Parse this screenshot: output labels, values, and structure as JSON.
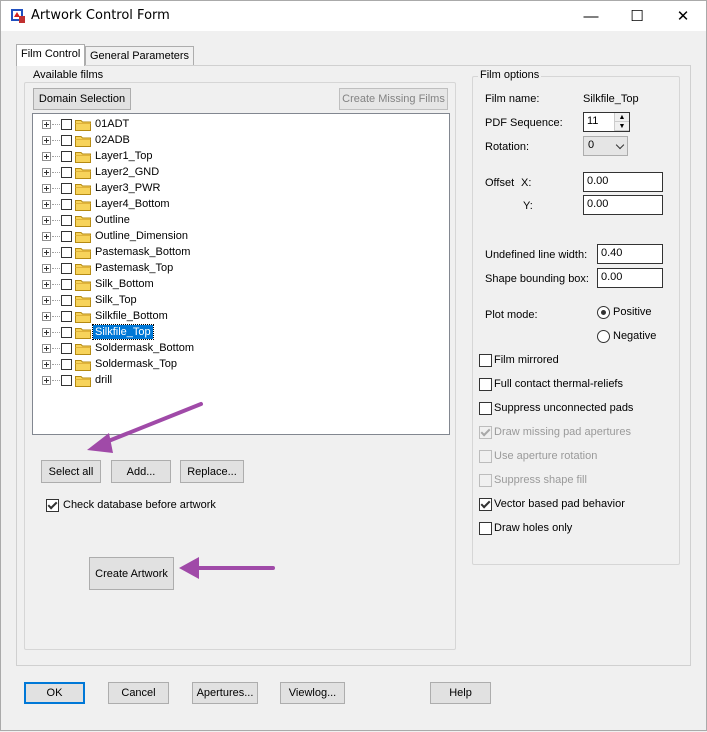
{
  "window": {
    "title": "Artwork Control Form",
    "minimize": "—",
    "maximize": "☐",
    "close": "✕"
  },
  "tabs": [
    {
      "label": "Film Control",
      "active": true
    },
    {
      "label": "General Parameters",
      "active": false
    }
  ],
  "available_films": {
    "group_label": "Available films",
    "domain_selection_label": "Domain Selection",
    "create_missing_films_label": "Create Missing Films",
    "films": [
      {
        "name": "01ADT",
        "selected": false
      },
      {
        "name": "02ADB",
        "selected": false
      },
      {
        "name": "Layer1_Top",
        "selected": false
      },
      {
        "name": "Layer2_GND",
        "selected": false
      },
      {
        "name": "Layer3_PWR",
        "selected": false
      },
      {
        "name": "Layer4_Bottom",
        "selected": false
      },
      {
        "name": "Outline",
        "selected": false
      },
      {
        "name": "Outline_Dimension",
        "selected": false
      },
      {
        "name": "Pastemask_Bottom",
        "selected": false
      },
      {
        "name": "Pastemask_Top",
        "selected": false
      },
      {
        "name": "Silk_Bottom",
        "selected": false
      },
      {
        "name": "Silk_Top",
        "selected": false
      },
      {
        "name": "Silkfile_Bottom",
        "selected": false
      },
      {
        "name": "Silkfile_Top",
        "selected": true
      },
      {
        "name": "Soldermask_Bottom",
        "selected": false
      },
      {
        "name": "Soldermask_Top",
        "selected": false
      },
      {
        "name": "drill",
        "selected": false
      }
    ],
    "select_all_label": "Select all",
    "add_label": "Add...",
    "replace_label": "Replace...",
    "check_database_label": "Check database before artwork",
    "check_database_checked": true,
    "create_artwork_label": "Create Artwork"
  },
  "film_options": {
    "group_label": "Film options",
    "film_name_label": "Film name:",
    "film_name_value": "Silkfile_Top",
    "pdf_sequence_label": "PDF Sequence:",
    "pdf_sequence_value": "11",
    "rotation_label": "Rotation:",
    "rotation_value": "0",
    "offset_label": "Offset",
    "offset_x_label": "X:",
    "offset_x_value": "0.00",
    "offset_y_label": "Y:",
    "offset_y_value": "0.00",
    "undefined_line_width_label": "Undefined line width:",
    "undefined_line_width_value": "0.40",
    "shape_bounding_box_label": "Shape bounding box:",
    "shape_bounding_box_value": "0.00",
    "plot_mode_label": "Plot mode:",
    "plot_mode_positive": "Positive",
    "plot_mode_negative": "Negative",
    "plot_mode_selected": "Positive",
    "options": [
      {
        "label": "Film mirrored",
        "checked": false,
        "enabled": true
      },
      {
        "label": "Full contact thermal-reliefs",
        "checked": false,
        "enabled": true
      },
      {
        "label": "Suppress unconnected pads",
        "checked": false,
        "enabled": true
      },
      {
        "label": "Draw missing pad apertures",
        "checked": true,
        "enabled": false
      },
      {
        "label": "Use aperture rotation",
        "checked": false,
        "enabled": false
      },
      {
        "label": "Suppress shape fill",
        "checked": false,
        "enabled": false
      },
      {
        "label": "Vector based pad behavior",
        "checked": true,
        "enabled": true
      },
      {
        "label": "Draw holes only",
        "checked": false,
        "enabled": true
      }
    ]
  },
  "bottom_buttons": {
    "ok": "OK",
    "cancel": "Cancel",
    "apertures": "Apertures...",
    "viewlog": "Viewlog...",
    "help": "Help"
  },
  "annotation_color": "#a04aa8"
}
